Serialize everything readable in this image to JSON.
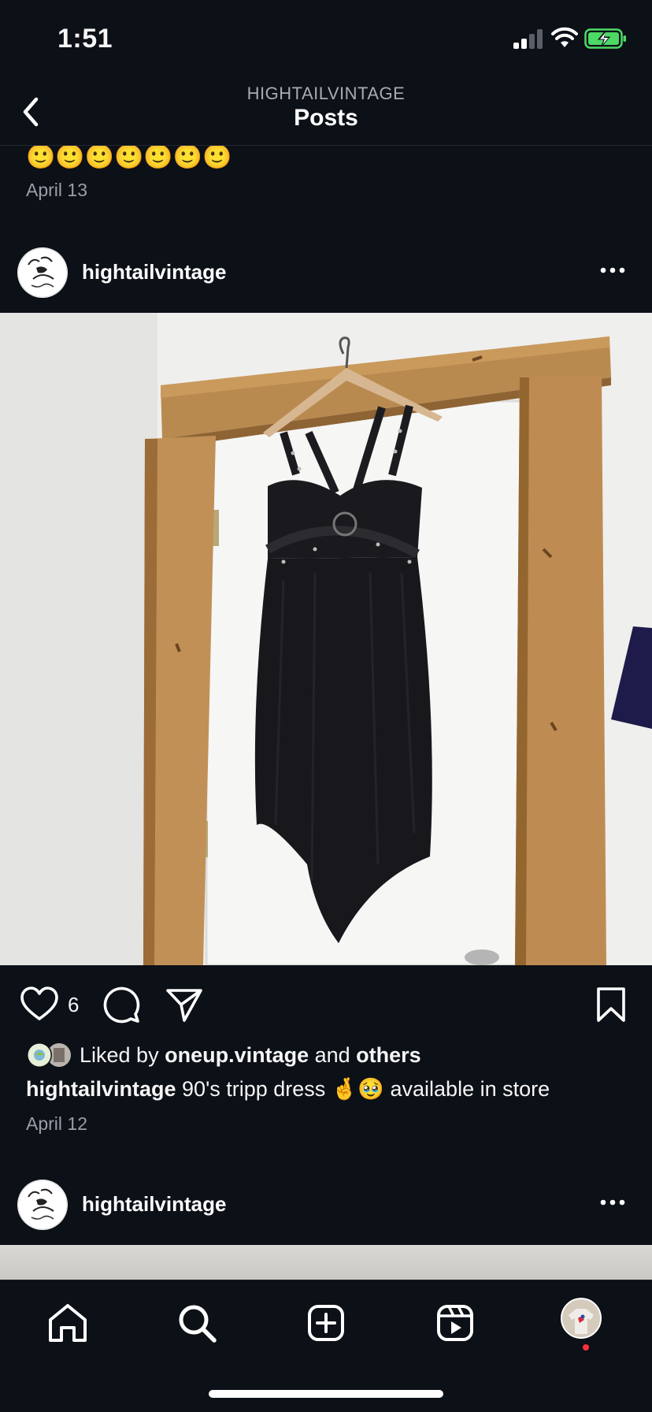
{
  "status_bar": {
    "time": "1:51",
    "battery_state": "charging"
  },
  "header": {
    "account": "HIGHTAILVINTAGE",
    "title": "Posts"
  },
  "previous_post": {
    "caption_emoji": "🙂🙂🙂🙂🙂🙂🙂",
    "date": "April 13"
  },
  "post": {
    "username": "hightailvintage",
    "likes_count": "6",
    "liked_by_prefix": "Liked by ",
    "liked_by_user": "oneup.vintage",
    "liked_by_and": " and ",
    "liked_by_others": "others",
    "caption_user": "hightailvintage",
    "caption_text": " 90's tripp dress 🤞🥹 available in store",
    "date": "April 12"
  },
  "next_post": {
    "username": "hightailvintage"
  },
  "tab_bar": {
    "items": [
      "home-icon",
      "search-icon",
      "create-icon",
      "reels-icon",
      "profile-avatar"
    ],
    "active": "profile-avatar",
    "notification_dot_color": "#ff3040"
  },
  "colors": {
    "background": "#0c1017",
    "text": "#f5f5f5",
    "muted": "#9a9ea6",
    "battery": "#4cd964"
  }
}
